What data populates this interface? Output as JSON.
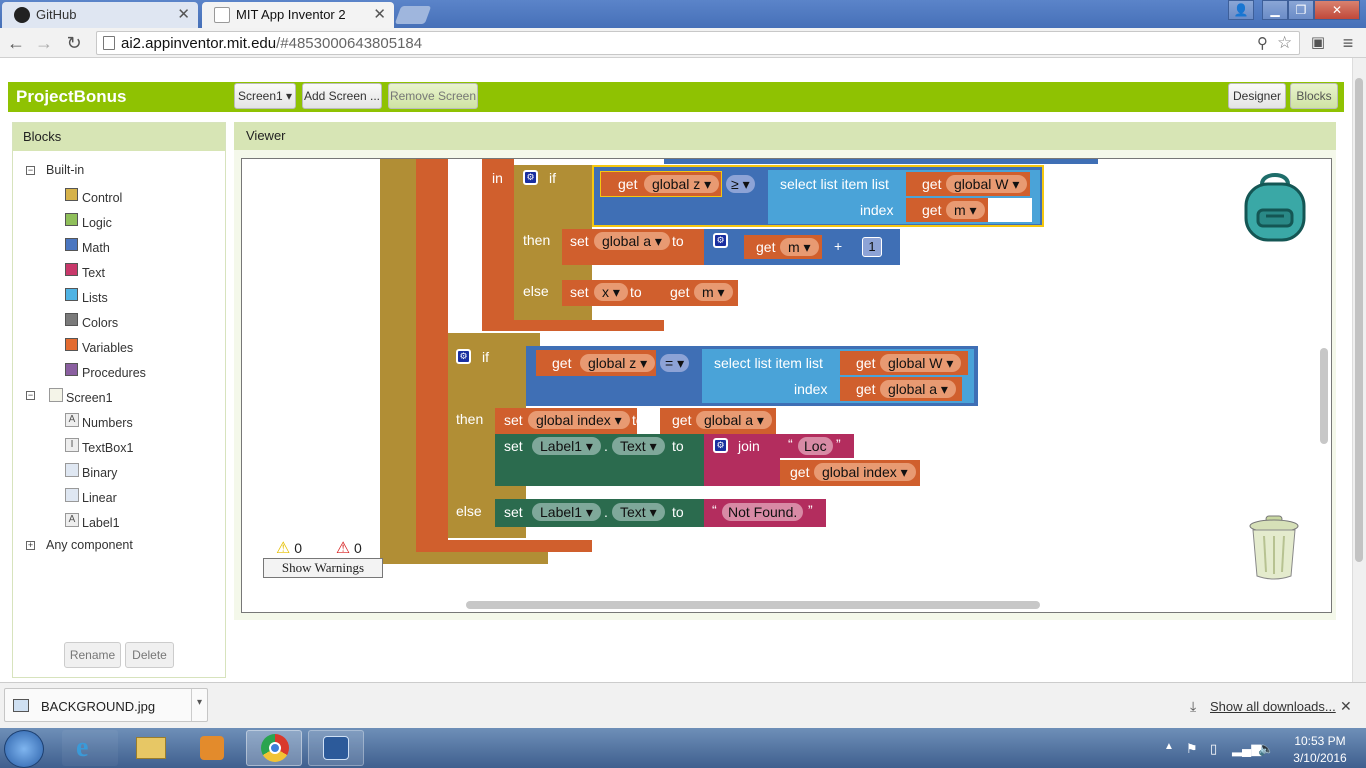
{
  "browser": {
    "tabs": [
      {
        "title": "GitHub",
        "icon": "github-icon"
      },
      {
        "title": "MIT App Inventor 2",
        "icon": "app-inventor-icon"
      }
    ],
    "url_host": "ai2.appinventor.mit.edu",
    "url_path": "/#4853000643805184",
    "window_buttons": [
      "user-icon",
      "minimize-icon",
      "restore-icon",
      "close-icon"
    ]
  },
  "app": {
    "project_title": "ProjectBonus",
    "screen_selector": "Screen1 ▾",
    "add_screen": "Add Screen ...",
    "remove_screen": "Remove Screen",
    "designer": "Designer",
    "blocks": "Blocks"
  },
  "blocks_panel": {
    "header": "Blocks",
    "builtin_label": "Built-in",
    "builtin": [
      {
        "label": "Control",
        "color": "#d6b24a"
      },
      {
        "label": "Logic",
        "color": "#8fbf5a"
      },
      {
        "label": "Math",
        "color": "#4a76c0"
      },
      {
        "label": "Text",
        "color": "#c8386a"
      },
      {
        "label": "Lists",
        "color": "#4fb3e4"
      },
      {
        "label": "Colors",
        "color": "#7a7a7a"
      },
      {
        "label": "Variables",
        "color": "#e36b30"
      },
      {
        "label": "Procedures",
        "color": "#8a5fa0"
      }
    ],
    "screen_label": "Screen1",
    "components": [
      "Numbers",
      "TextBox1",
      "Binary",
      "Linear",
      "Label1"
    ],
    "any_component": "Any component",
    "rename": "Rename",
    "delete": "Delete"
  },
  "viewer": {
    "header": "Viewer",
    "warnings_count": "0",
    "errors_count": "0",
    "show_warnings": "Show Warnings"
  },
  "blocks": {
    "in": "in",
    "if": "if",
    "then": "then",
    "else": "else",
    "get": "get",
    "set": "set",
    "to": "to",
    "global_z": "global z ▾",
    "global_W": "global W ▾",
    "global_a": "global a ▾",
    "global_index": "global index ▾",
    "m": "m ▾",
    "x": "x ▾",
    "gte": "≥ ▾",
    "eq": "= ▾",
    "plus": "+",
    "one": "1",
    "select_list_item": "select list item  list",
    "index": "index",
    "label1": "Label1 ▾",
    "dot": ".",
    "text_prop": "Text ▾",
    "join": "join",
    "loc": "Loc",
    "not_found": "Not Found.",
    "quote_open": "“",
    "quote_close": "”"
  },
  "downloads": {
    "file": "BACKGROUND.jpg",
    "show_all": "Show all downloads..."
  },
  "taskbar": {
    "time": "10:53 PM",
    "date": "3/10/2016"
  }
}
